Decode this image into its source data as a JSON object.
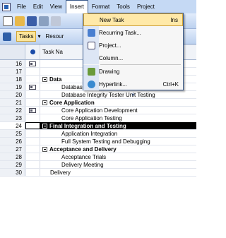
{
  "menubar": {
    "items": [
      "File",
      "Edit",
      "View",
      "Insert",
      "Format",
      "Tools",
      "Project"
    ]
  },
  "toolbar": {
    "tasks_label": "Tasks",
    "resource_label": "Resour"
  },
  "grid": {
    "header_task_name": "Task Na",
    "rows": [
      {
        "id": "16",
        "name": "",
        "indicator": true,
        "summary": false,
        "level": 0
      },
      {
        "id": "17",
        "name": "",
        "indicator": false,
        "summary": false,
        "level": 0
      },
      {
        "id": "18",
        "name": "Data",
        "indicator": false,
        "summary": true,
        "level": 0
      },
      {
        "id": "19",
        "name": "Database Integrity Tester Development",
        "indicator": true,
        "summary": false,
        "level": 2
      },
      {
        "id": "20",
        "name": "Database Integrity Tester Unit Testing",
        "indicator": false,
        "summary": false,
        "level": 2
      },
      {
        "id": "21",
        "name": "Core Application",
        "indicator": false,
        "summary": true,
        "level": 0
      },
      {
        "id": "22",
        "name": "Core Application Development",
        "indicator": true,
        "summary": false,
        "level": 2
      },
      {
        "id": "23",
        "name": "Core Application Testing",
        "indicator": false,
        "summary": false,
        "level": 2
      },
      {
        "id": "24",
        "name": "Final Integration and Testing",
        "indicator": false,
        "summary": true,
        "level": 0,
        "selected": true
      },
      {
        "id": "25",
        "name": "Application Integration",
        "indicator": false,
        "summary": false,
        "level": 2
      },
      {
        "id": "26",
        "name": "Full System Testing and Debugging",
        "indicator": false,
        "summary": false,
        "level": 2
      },
      {
        "id": "27",
        "name": "Acceptance and Delivery",
        "indicator": false,
        "summary": true,
        "level": 0
      },
      {
        "id": "28",
        "name": "Acceptance Trials",
        "indicator": false,
        "summary": false,
        "level": 2
      },
      {
        "id": "29",
        "name": "Delivery Meeting",
        "indicator": false,
        "summary": false,
        "level": 2
      },
      {
        "id": "30",
        "name": "Delivery",
        "indicator": false,
        "summary": false,
        "level": 1
      }
    ]
  },
  "insert_menu": {
    "new_task": "New Task",
    "new_task_shortcut": "Ins",
    "recurring_task": "Recurring Task...",
    "project": "Project...",
    "column": "Column...",
    "drawing": "Drawing",
    "hyperlink": "Hyperlink...",
    "hyperlink_shortcut": "Ctrl+K",
    "more": "»"
  },
  "colors": {
    "menubar": "#c5d9f4",
    "highlight": "#ffe9a8",
    "selected_row": "#000000"
  }
}
